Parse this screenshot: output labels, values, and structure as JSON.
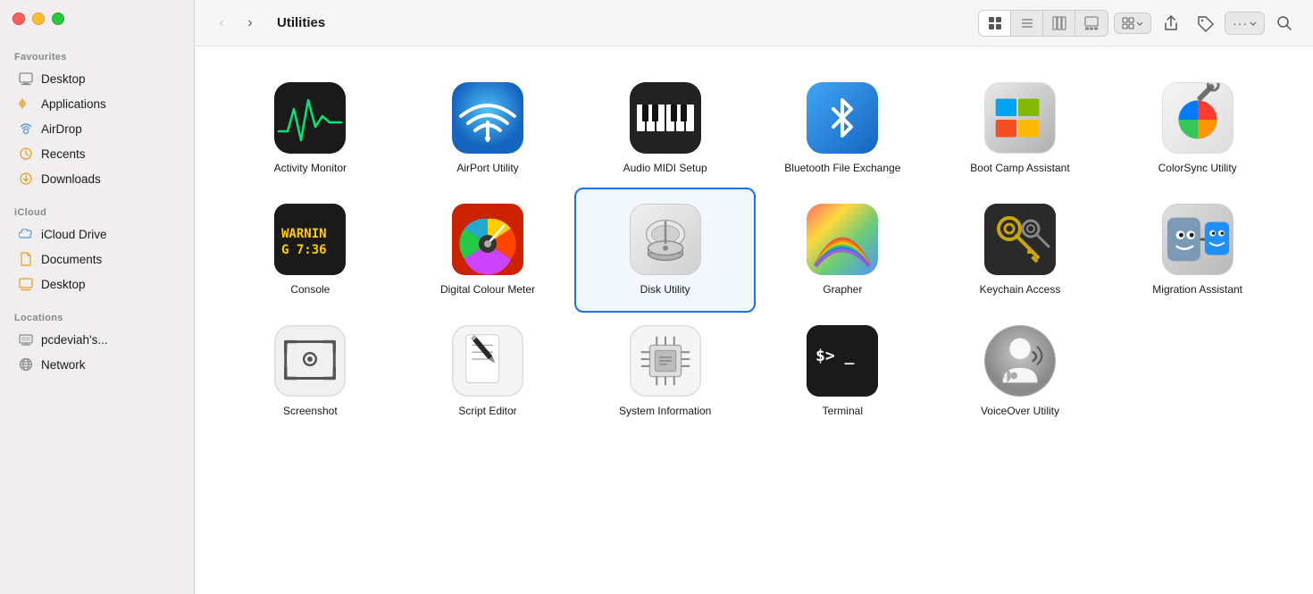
{
  "window": {
    "title": "Utilities"
  },
  "traffic_lights": {
    "red": "close",
    "yellow": "minimize",
    "green": "maximize"
  },
  "sidebar": {
    "favourites_header": "Favourites",
    "icloud_header": "iCloud",
    "locations_header": "Locations",
    "items_favourites": [
      {
        "id": "desktop",
        "label": "Desktop",
        "icon": "desktop"
      },
      {
        "id": "applications",
        "label": "Applications",
        "icon": "applications"
      },
      {
        "id": "airdrop",
        "label": "AirDrop",
        "icon": "airdrop"
      },
      {
        "id": "recents",
        "label": "Recents",
        "icon": "recents"
      },
      {
        "id": "downloads",
        "label": "Downloads",
        "icon": "downloads"
      }
    ],
    "items_icloud": [
      {
        "id": "icloud-drive",
        "label": "iCloud Drive",
        "icon": "icloud-drive"
      },
      {
        "id": "documents",
        "label": "Documents",
        "icon": "documents"
      },
      {
        "id": "desktop-icloud",
        "label": "Desktop",
        "icon": "desktop"
      }
    ],
    "items_locations": [
      {
        "id": "pcdeviah",
        "label": "pcdeviah's...",
        "icon": "computer"
      },
      {
        "id": "network",
        "label": "Network",
        "icon": "network"
      }
    ]
  },
  "toolbar": {
    "back_label": "‹",
    "forward_label": "›",
    "title": "Utilities",
    "view_grid_label": "⊞",
    "view_list_label": "☰",
    "view_columns_label": "⊟",
    "view_gallery_label": "⊠",
    "tag_label": "Tag",
    "more_label": "···",
    "search_label": "🔍"
  },
  "apps": [
    {
      "id": "activity-monitor",
      "label": "Activity Monitor",
      "selected": false
    },
    {
      "id": "airport-utility",
      "label": "AirPort Utility",
      "selected": false
    },
    {
      "id": "audio-midi-setup",
      "label": "Audio MIDI Setup",
      "selected": false
    },
    {
      "id": "bluetooth-file-exchange",
      "label": "Bluetooth File\nExchange",
      "selected": false
    },
    {
      "id": "boot-camp-assistant",
      "label": "Boot Camp\nAssistant",
      "selected": false
    },
    {
      "id": "colorsync-utility",
      "label": "ColorSync Utility",
      "selected": false
    },
    {
      "id": "console",
      "label": "Console",
      "selected": false
    },
    {
      "id": "digital-colour-meter",
      "label": "Digital Colour\nMeter",
      "selected": false
    },
    {
      "id": "disk-utility",
      "label": "Disk Utility",
      "selected": true
    },
    {
      "id": "grapher",
      "label": "Grapher",
      "selected": false
    },
    {
      "id": "keychain-access",
      "label": "Keychain Access",
      "selected": false
    },
    {
      "id": "migration-assistant",
      "label": "Migration\nAssistant",
      "selected": false
    },
    {
      "id": "screenshot",
      "label": "Screenshot",
      "selected": false
    },
    {
      "id": "script-editor",
      "label": "Script Editor",
      "selected": false
    },
    {
      "id": "system-information",
      "label": "System\nInformation",
      "selected": false
    },
    {
      "id": "terminal",
      "label": "Terminal",
      "selected": false
    },
    {
      "id": "voiceover-utility",
      "label": "VoiceOver Utility",
      "selected": false
    }
  ]
}
